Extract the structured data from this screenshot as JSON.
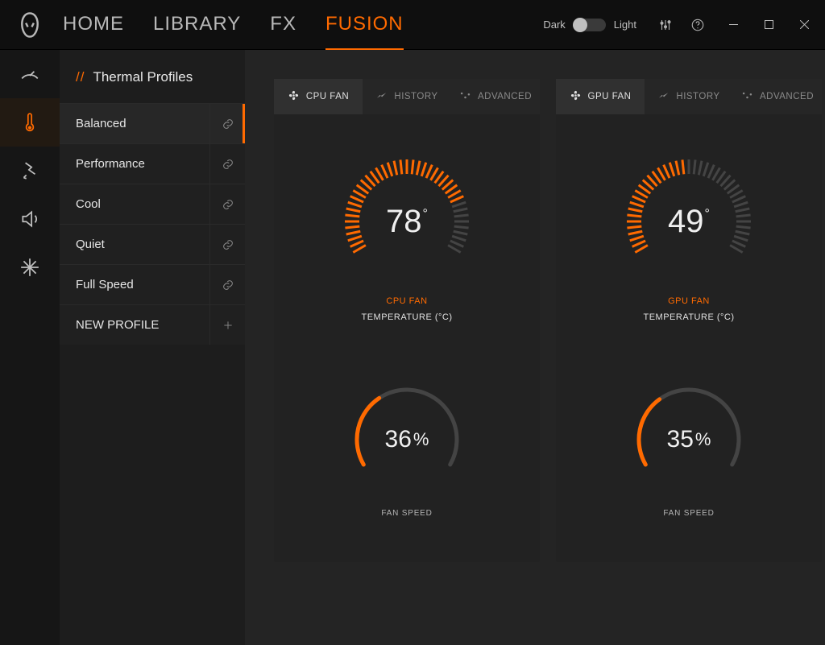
{
  "header": {
    "nav": [
      {
        "label": "HOME",
        "active": false
      },
      {
        "label": "LIBRARY",
        "active": false
      },
      {
        "label": "FX",
        "active": false
      },
      {
        "label": "FUSION",
        "active": true
      }
    ],
    "theme": {
      "dark_label": "Dark",
      "light_label": "Light"
    }
  },
  "rail": [
    {
      "name": "overclock-icon"
    },
    {
      "name": "thermal-icon",
      "active": true
    },
    {
      "name": "power-icon"
    },
    {
      "name": "audio-icon"
    },
    {
      "name": "misc-icon"
    }
  ],
  "sidebar": {
    "title": "Thermal Profiles",
    "slashes": "//",
    "profiles": [
      {
        "name": "Balanced",
        "active": true,
        "action": "link"
      },
      {
        "name": "Performance",
        "action": "link"
      },
      {
        "name": "Cool",
        "action": "link"
      },
      {
        "name": "Quiet",
        "action": "link"
      },
      {
        "name": "Full Speed",
        "action": "link"
      },
      {
        "name": "NEW PROFILE",
        "action": "add",
        "new": true
      }
    ]
  },
  "panels": [
    {
      "tabs": [
        {
          "label": "CPU FAN",
          "icon": "fan",
          "active": true
        },
        {
          "label": "HISTORY",
          "icon": "history"
        },
        {
          "label": "ADVANCED",
          "icon": "advanced"
        }
      ],
      "temp": {
        "value": "78",
        "unit": "°",
        "label_top": "CPU FAN",
        "label_bottom": "TEMPERATURE (°C)",
        "fill": 0.78
      },
      "speed": {
        "value": "36",
        "unit": "%",
        "label": "FAN SPEED",
        "fill": 0.36
      }
    },
    {
      "tabs": [
        {
          "label": "GPU FAN",
          "icon": "fan",
          "active": true
        },
        {
          "label": "HISTORY",
          "icon": "history"
        },
        {
          "label": "ADVANCED",
          "icon": "advanced"
        }
      ],
      "temp": {
        "value": "49",
        "unit": "°",
        "label_top": "GPU FAN",
        "label_bottom": "TEMPERATURE (°C)",
        "fill": 0.49
      },
      "speed": {
        "value": "35",
        "unit": "%",
        "label": "FAN SPEED",
        "fill": 0.35
      }
    }
  ],
  "chart_data": [
    {
      "type": "bar",
      "title": "CPU FAN Temperature",
      "categories": [
        "Temperature (°C)"
      ],
      "values": [
        78
      ],
      "ylim": [
        0,
        100
      ],
      "ylabel": "°C"
    },
    {
      "type": "bar",
      "title": "CPU Fan Speed",
      "categories": [
        "Fan Speed"
      ],
      "values": [
        36
      ],
      "ylim": [
        0,
        100
      ],
      "ylabel": "%"
    },
    {
      "type": "bar",
      "title": "GPU FAN Temperature",
      "categories": [
        "Temperature (°C)"
      ],
      "values": [
        49
      ],
      "ylim": [
        0,
        100
      ],
      "ylabel": "°C"
    },
    {
      "type": "bar",
      "title": "GPU Fan Speed",
      "categories": [
        "Fan Speed"
      ],
      "values": [
        35
      ],
      "ylim": [
        0,
        100
      ],
      "ylabel": "%"
    }
  ]
}
